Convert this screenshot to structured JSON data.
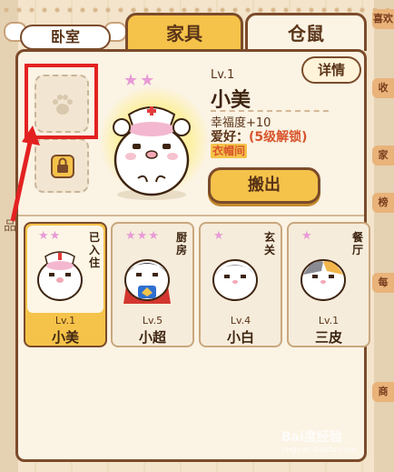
{
  "header": {
    "room_label": "卧室",
    "tabs": [
      {
        "label": "家具",
        "active": false
      },
      {
        "label": "仓鼠",
        "active": true
      }
    ]
  },
  "side_tags": [
    "喜欢",
    "收",
    "家",
    "榜",
    "每",
    "商"
  ],
  "side_left": "品",
  "detail": {
    "details_button": "详情",
    "stars": "★★",
    "level": "Lv.1",
    "name": "小美",
    "happiness": "幸福度+10",
    "hobby_label": "爱好：",
    "hobby_value": "(5级解锁)",
    "wardrobe": "衣帽间",
    "move_out_button": "搬出"
  },
  "cards": [
    {
      "stars": "★★",
      "room": "已入住",
      "level": "Lv.1",
      "name": "小美",
      "selected": true
    },
    {
      "stars": "★★★",
      "room": "厨房",
      "level": "Lv.5",
      "name": "小超",
      "selected": false
    },
    {
      "stars": "★",
      "room": "玄关",
      "level": "Lv.4",
      "name": "小白",
      "selected": false
    },
    {
      "stars": "★",
      "room": "餐厅",
      "level": "Lv.1",
      "name": "三皮",
      "selected": false
    }
  ],
  "colors": {
    "accent": "#f5c34a",
    "border": "#7b4b2a",
    "highlight": "#e32121",
    "star": "#e79ad6"
  },
  "watermark": {
    "brand": "Bai度经验",
    "url": "jingyan.baidu.com"
  }
}
